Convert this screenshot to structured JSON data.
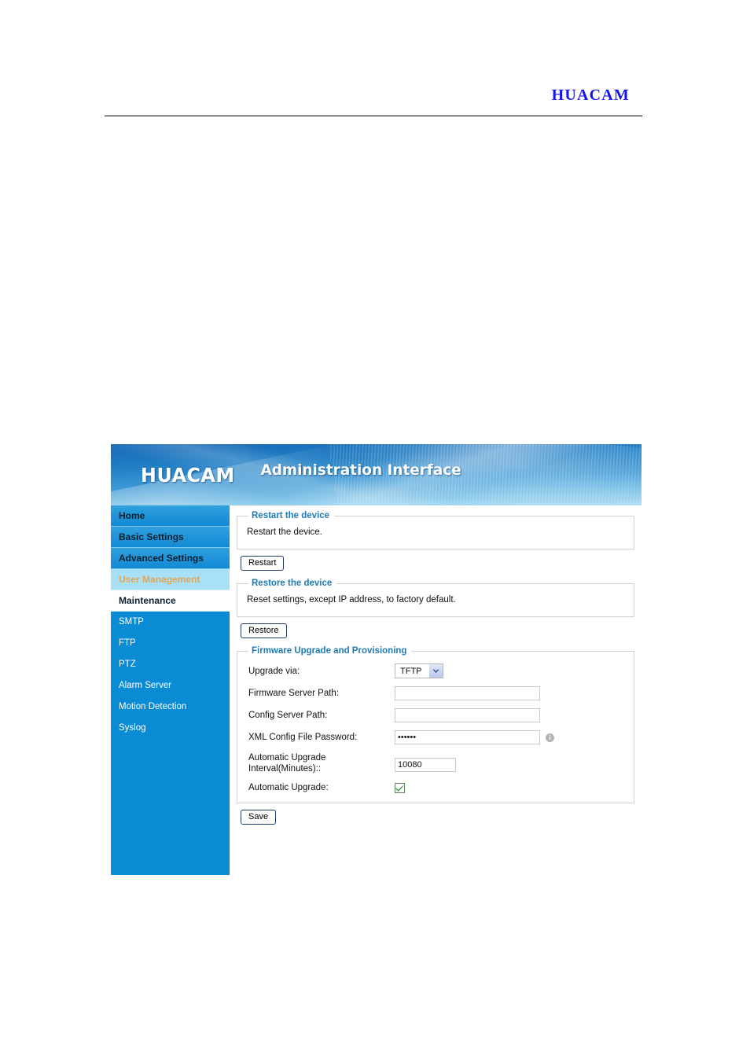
{
  "document": {
    "brand": "HUACAM"
  },
  "app": {
    "logo": "HUACAM",
    "title": "Administration Interface"
  },
  "sidebar": {
    "items": [
      {
        "label": "Home",
        "state": "top"
      },
      {
        "label": "Basic Settings",
        "state": "top"
      },
      {
        "label": "Advanced Settings",
        "state": "top"
      },
      {
        "label": "User Management",
        "state": "selected"
      },
      {
        "label": "Maintenance",
        "state": "current"
      },
      {
        "label": "SMTP",
        "state": "sub"
      },
      {
        "label": "FTP",
        "state": "sub"
      },
      {
        "label": "PTZ",
        "state": "sub"
      },
      {
        "label": "Alarm Server",
        "state": "sub"
      },
      {
        "label": "Motion Detection",
        "state": "sub"
      },
      {
        "label": "Syslog",
        "state": "sub"
      }
    ]
  },
  "restart_section": {
    "legend": "Restart the device",
    "description": "Restart the device.",
    "button": "Restart"
  },
  "restore_section": {
    "legend": "Restore the device",
    "description": "Reset settings, except IP address, to factory default.",
    "button": "Restore"
  },
  "firmware_section": {
    "legend": "Firmware Upgrade and Provisioning",
    "fields": {
      "upgrade_via_label": "Upgrade via:",
      "upgrade_via_value": "TFTP",
      "firmware_server_label": "Firmware Server Path:",
      "firmware_server_value": "",
      "config_server_label": "Config Server Path:",
      "config_server_value": "",
      "xml_password_label": "XML Config File Password:",
      "xml_password_value": "••••••",
      "interval_label": "Automatic Upgrade Interval(Minutes)::",
      "interval_value": "10080",
      "auto_upgrade_label": "Automatic Upgrade:",
      "auto_upgrade_checked": "true"
    },
    "info_icon_glyph": "i",
    "save_button": "Save"
  }
}
